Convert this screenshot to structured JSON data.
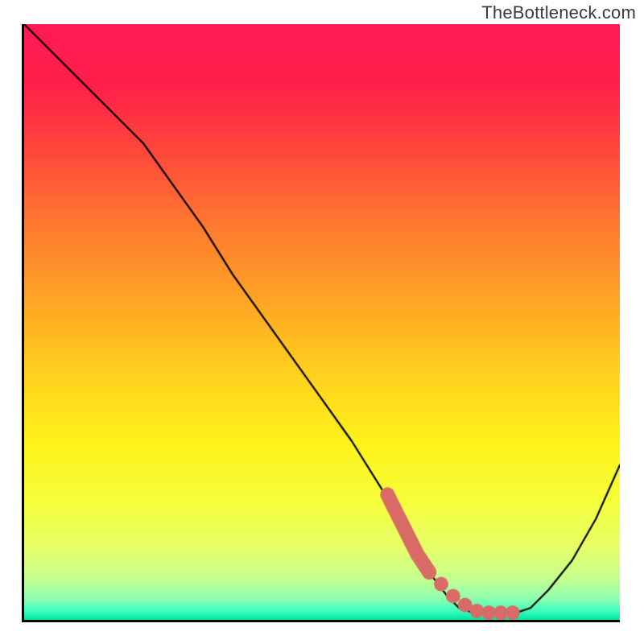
{
  "watermark": "TheBottleneck.com",
  "chart_data": {
    "type": "line",
    "title": "",
    "xlabel": "",
    "ylabel": "",
    "xlim": [
      0,
      100
    ],
    "ylim": [
      0,
      100
    ],
    "series": [
      {
        "name": "main-curve",
        "x": [
          0,
          8,
          15,
          20,
          25,
          30,
          35,
          40,
          45,
          50,
          55,
          60,
          63,
          65,
          68,
          71,
          73,
          76,
          79,
          82,
          85,
          88,
          92,
          96,
          100
        ],
        "y": [
          100,
          92,
          85,
          80,
          73,
          66,
          58,
          51,
          44,
          37,
          30,
          22,
          17,
          13,
          8,
          4,
          2,
          1,
          1,
          1,
          2,
          5,
          10,
          17,
          26
        ]
      },
      {
        "name": "highlight-dots",
        "x": [
          61,
          62,
          63,
          64,
          65,
          66,
          68,
          70,
          72,
          74,
          76,
          78,
          80,
          82
        ],
        "y": [
          21,
          19,
          17,
          15,
          13,
          11,
          8,
          6,
          4,
          2.5,
          1.5,
          1.2,
          1.2,
          1.2
        ]
      }
    ],
    "gradient_stops": [
      {
        "offset": 0.0,
        "color": "#ff1a55"
      },
      {
        "offset": 0.1,
        "color": "#ff1f4a"
      },
      {
        "offset": 0.22,
        "color": "#ff4a3a"
      },
      {
        "offset": 0.34,
        "color": "#ff7a30"
      },
      {
        "offset": 0.46,
        "color": "#ffa426"
      },
      {
        "offset": 0.58,
        "color": "#ffcf1e"
      },
      {
        "offset": 0.7,
        "color": "#fff21a"
      },
      {
        "offset": 0.8,
        "color": "#f6ff3a"
      },
      {
        "offset": 0.88,
        "color": "#e6ff6a"
      },
      {
        "offset": 0.93,
        "color": "#c6ff90"
      },
      {
        "offset": 0.965,
        "color": "#8effb0"
      },
      {
        "offset": 0.985,
        "color": "#3dffbf"
      },
      {
        "offset": 1.0,
        "color": "#00e59e"
      }
    ],
    "highlight_color": "#d96b66",
    "curve_color": "#000000"
  }
}
